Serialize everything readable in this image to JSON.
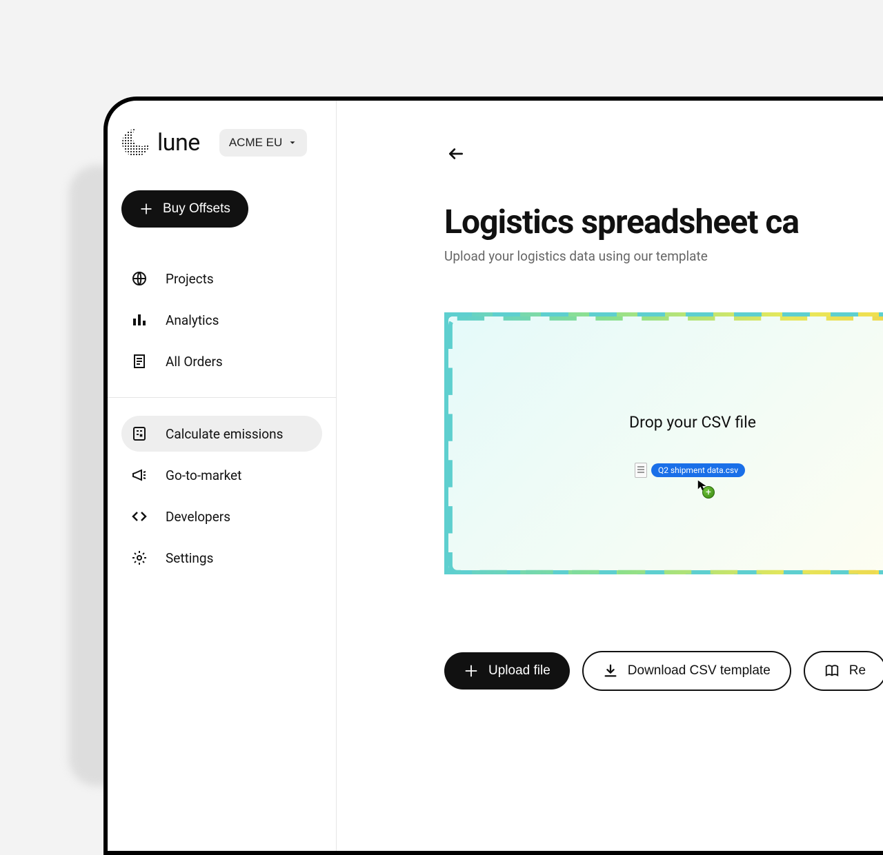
{
  "brand": {
    "name": "lune"
  },
  "org_switcher": {
    "label": "ACME EU"
  },
  "cta": {
    "label": "Buy Offsets"
  },
  "sidebar": {
    "group1": [
      {
        "label": "Projects",
        "icon": "globe-icon"
      },
      {
        "label": "Analytics",
        "icon": "bars-icon"
      },
      {
        "label": "All Orders",
        "icon": "receipt-icon"
      }
    ],
    "group2": [
      {
        "label": "Calculate emissions",
        "icon": "calculator-icon",
        "active": true
      },
      {
        "label": "Go-to-market",
        "icon": "megaphone-icon"
      },
      {
        "label": "Developers",
        "icon": "code-icon"
      },
      {
        "label": "Settings",
        "icon": "gear-icon"
      }
    ]
  },
  "page": {
    "title": "Logistics spreadsheet ca",
    "subtitle": "Upload your logistics data using our template"
  },
  "dropzone": {
    "text": "Drop your CSV file",
    "dragged_file": "Q2 shipment data.csv"
  },
  "actions": {
    "upload": "Upload file",
    "download_template": "Download CSV template",
    "read": "Re"
  }
}
